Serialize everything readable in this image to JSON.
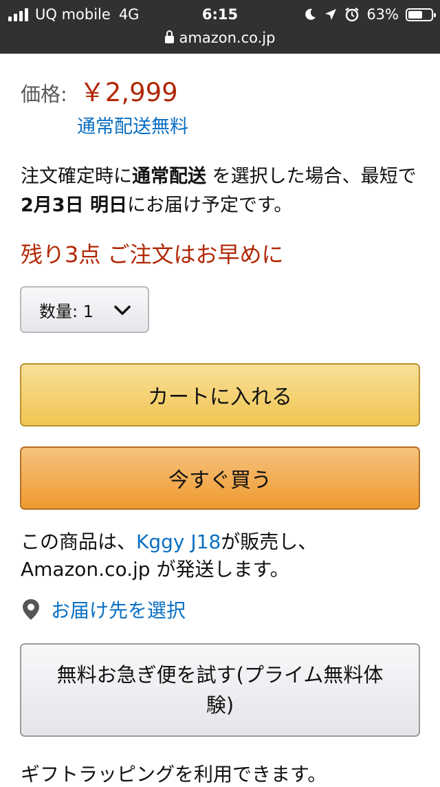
{
  "status_bar": {
    "carrier": "UQ mobile",
    "network": "4G",
    "time": "6:15",
    "battery": "63%",
    "battery_level": 0.63,
    "url": "amazon.co.jp"
  },
  "product": {
    "price_label": "価格:",
    "price": "￥2,999",
    "free_shipping": "通常配送無料",
    "delivery": {
      "p1": "注文確定時に",
      "b1": "通常配送",
      "p2": " を選択した場合、最短で",
      "b2": "2月3日 明日",
      "p3": "にお届け予定です。"
    },
    "stock_notice": "残り3点 ご注文はお早めに",
    "quantity_label": "数量: 1",
    "quantity_value": "1"
  },
  "buttons": {
    "add_to_cart": "カートに入れる",
    "buy_now": "今すぐ買う",
    "prime_trial": "無料お急ぎ便を試す(プライム無料体験)"
  },
  "seller": {
    "p1": "この商品は、",
    "seller_name": "Kggy J18",
    "p2": "が販売し、Amazon.co.jp が発送します。"
  },
  "address_link": "お届け先を選択",
  "gift_text": "ギフトラッピングを利用できます。",
  "icons": {
    "signal": "signal-bars-icon",
    "moon": "moon-icon",
    "location": "location-arrow-icon",
    "alarm": "alarm-clock-icon",
    "battery": "battery-icon",
    "lock": "lock-icon",
    "chevron": "chevron-down-icon",
    "pin": "map-pin-icon"
  },
  "colors": {
    "status_bar_bg": "#313131",
    "price": "#b12704",
    "link": "#0a6fc2",
    "cart_button": "#f1c551",
    "buy_button": "#ef9a2f"
  }
}
